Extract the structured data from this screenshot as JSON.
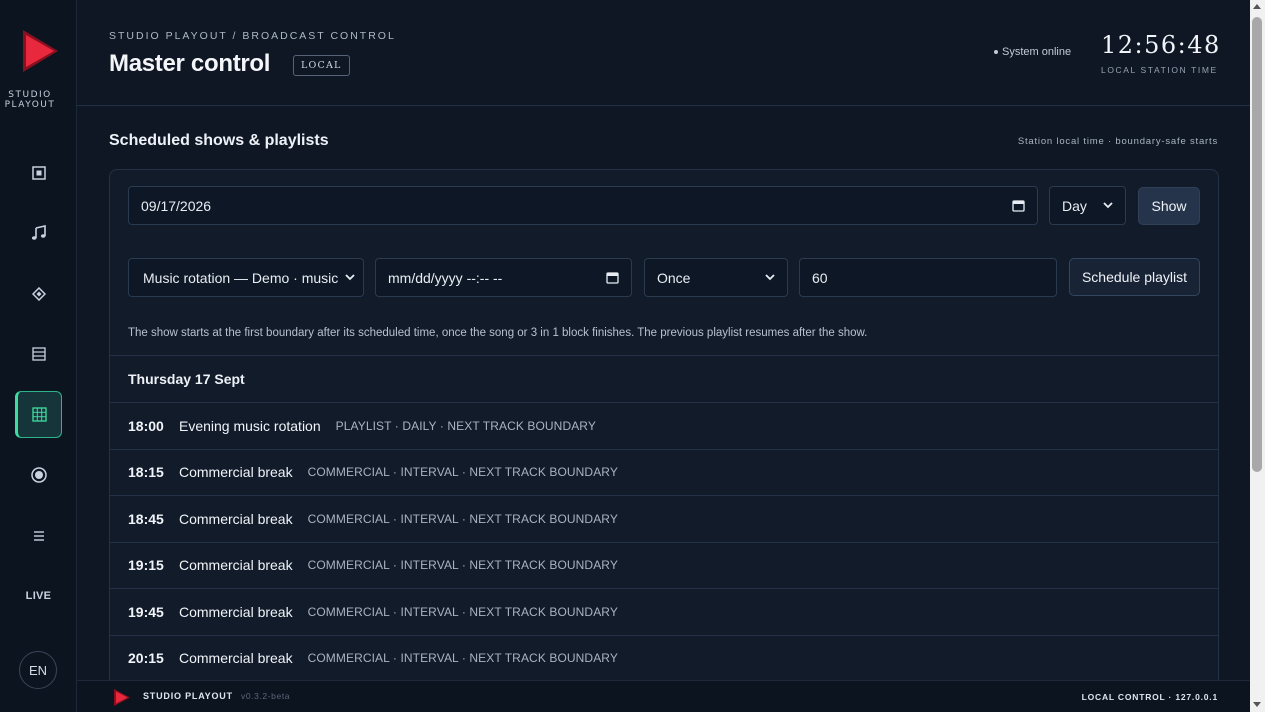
{
  "app": {
    "brand": "STUDIO PLAYOUT",
    "accent_color": "#e8283c",
    "active_color": "#3fdca0"
  },
  "sidebar": {
    "items": [
      {
        "icon": "monitor-icon",
        "label": ""
      },
      {
        "icon": "music-note-icon",
        "label": ""
      },
      {
        "icon": "diamond-icon",
        "label": ""
      },
      {
        "icon": "list-icon",
        "label": ""
      },
      {
        "icon": "calendar-grid-icon",
        "label": "",
        "active": true
      },
      {
        "icon": "record-icon",
        "label": ""
      },
      {
        "icon": "menu-icon",
        "label": ""
      },
      {
        "icon": "",
        "label": "LIVE"
      }
    ],
    "language": "EN"
  },
  "header": {
    "breadcrumb": "STUDIO PLAYOUT / BROADCAST CONTROL",
    "title": "Master control",
    "badge": "LOCAL",
    "status": "System online",
    "clock": "12:56:48",
    "clock_label": "LOCAL STATION TIME"
  },
  "schedule": {
    "title": "Scheduled shows & playlists",
    "note": "Station local time · boundary-safe starts",
    "date_value": "09/17/2026",
    "view_select": "Day",
    "show_button": "Show",
    "playlist_select": "Music rotation — Demo · music",
    "datetime_placeholder": "mm/dd/yyyy --:-- --",
    "repeat_select": "Once",
    "duration_value": "60",
    "schedule_button": "Schedule playlist",
    "hint": "The show starts at the first boundary after its scheduled time, once the song or 3 in 1 block finishes. The previous playlist resumes after the show.",
    "day_heading": "Thursday 17 Sept",
    "entries": [
      {
        "time": "18:00",
        "name": "Evening music rotation",
        "meta": "PLAYLIST · DAILY · NEXT TRACK BOUNDARY"
      },
      {
        "time": "18:15",
        "name": "Commercial break",
        "meta": "COMMERCIAL · INTERVAL · NEXT TRACK BOUNDARY"
      },
      {
        "time": "18:45",
        "name": "Commercial break",
        "meta": "COMMERCIAL · INTERVAL · NEXT TRACK BOUNDARY"
      },
      {
        "time": "19:15",
        "name": "Commercial break",
        "meta": "COMMERCIAL · INTERVAL · NEXT TRACK BOUNDARY"
      },
      {
        "time": "19:45",
        "name": "Commercial break",
        "meta": "COMMERCIAL · INTERVAL · NEXT TRACK BOUNDARY"
      },
      {
        "time": "20:15",
        "name": "Commercial break",
        "meta": "COMMERCIAL · INTERVAL · NEXT TRACK BOUNDARY"
      }
    ]
  },
  "footer": {
    "name": "STUDIO PLAYOUT",
    "version": "v0.3.2-beta",
    "right": "LOCAL CONTROL · 127.0.0.1"
  }
}
